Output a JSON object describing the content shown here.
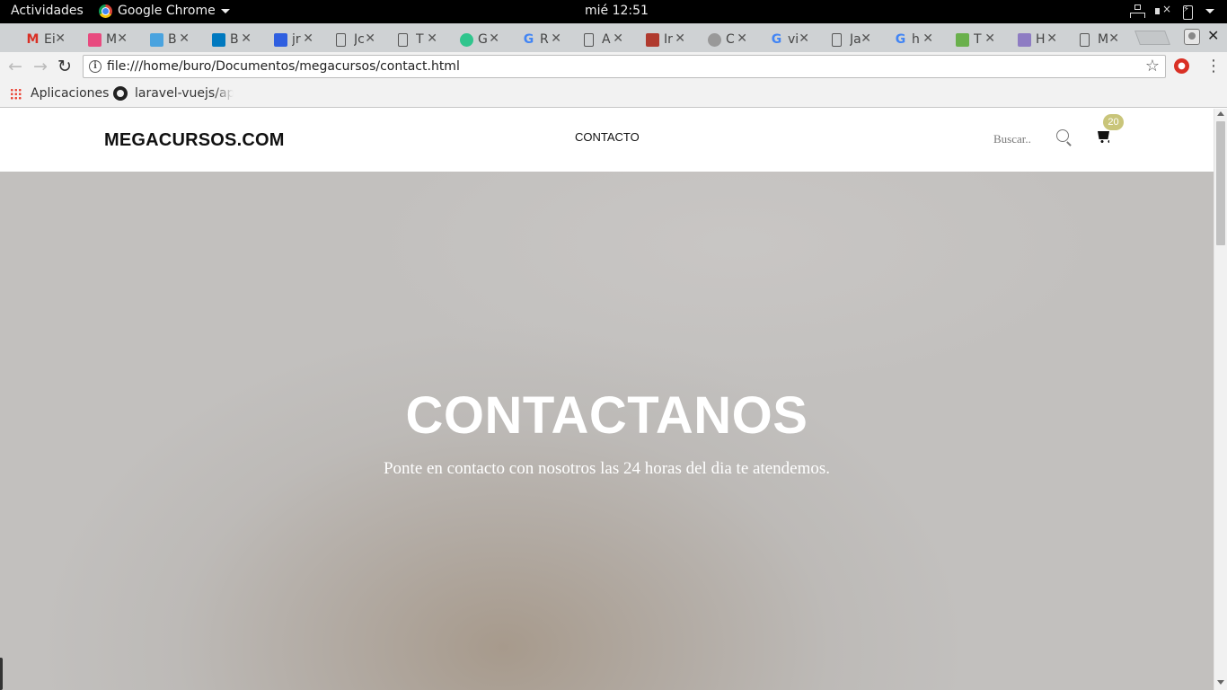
{
  "topbar": {
    "activities": "Actividades",
    "app_name": "Google Chrome",
    "clock": "mié 12:51"
  },
  "tabs": [
    {
      "title": "Ei",
      "favicon": "gmail-icon",
      "color": "#d93025",
      "glyph": "M"
    },
    {
      "title": "M",
      "favicon": "books-icon",
      "color": "#e84a7f",
      "glyph": ""
    },
    {
      "title": "B",
      "favicon": "chart-icon",
      "color": "#4aa3df",
      "glyph": ""
    },
    {
      "title": "B",
      "favicon": "trello-icon",
      "color": "#0079bf",
      "glyph": ""
    },
    {
      "title": "jr",
      "favicon": "shield-icon",
      "color": "#2f5fe0",
      "glyph": ""
    },
    {
      "title": "Jc",
      "favicon": "document-icon",
      "color": "",
      "glyph": ""
    },
    {
      "title": "T",
      "favicon": "document-icon",
      "color": "",
      "glyph": ""
    },
    {
      "title": "G",
      "favicon": "growth-icon",
      "color": "#30c58d",
      "glyph": ""
    },
    {
      "title": "R",
      "favicon": "google-icon",
      "color": "",
      "glyph": "G"
    },
    {
      "title": "A",
      "favicon": "document-icon",
      "color": "",
      "glyph": ""
    },
    {
      "title": "Ir",
      "favicon": "building-icon",
      "color": "#b03a2e",
      "glyph": ""
    },
    {
      "title": "C",
      "favicon": "globe-icon",
      "color": "#999999",
      "glyph": ""
    },
    {
      "title": "vi",
      "favicon": "google-icon",
      "color": "",
      "glyph": "G"
    },
    {
      "title": "Ja",
      "favicon": "document-icon",
      "color": "",
      "glyph": ""
    },
    {
      "title": "h",
      "favicon": "google-icon",
      "color": "",
      "glyph": "G"
    },
    {
      "title": "T",
      "favicon": "leaf-icon",
      "color": "#6ab04c",
      "glyph": ""
    },
    {
      "title": "H",
      "favicon": "brackets-icon",
      "color": "#8e7cc3",
      "glyph": ""
    },
    {
      "title": "M",
      "favicon": "document-icon",
      "color": "",
      "glyph": "",
      "active": true
    }
  ],
  "toolbar": {
    "url": "file:///home/buro/Documentos/megacursos/contact.html"
  },
  "bookmarks": {
    "apps_label": "Aplicaciones",
    "github_label": "laravel-vuejs/app"
  },
  "site": {
    "brand": "MEGACURSOS.COM",
    "nav_contact": "CONTACTO",
    "search_placeholder": "Buscar..",
    "cart_count": "20"
  },
  "hero": {
    "title": "CONTACTANOS",
    "subtitle": "Ponte en contacto con nosotros las 24 horas del dia te atendemos."
  }
}
